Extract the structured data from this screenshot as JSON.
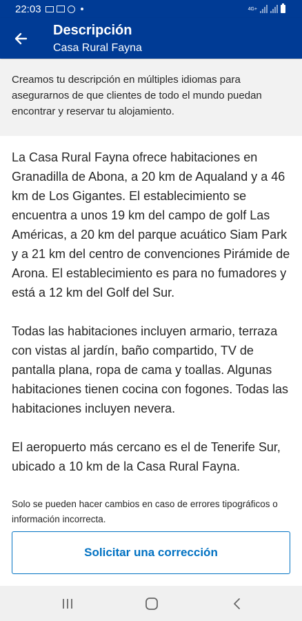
{
  "status_bar": {
    "time": "22:03",
    "network_label": "4G+"
  },
  "app_bar": {
    "title": "Descripción",
    "subtitle": "Casa Rural Fayna"
  },
  "info": {
    "text": "Creamos tu descripción en múltiples idiomas para asegurarnos de que clientes de todo el mundo puedan encontrar y reservar tu alojamiento."
  },
  "description": {
    "paragraphs": [
      "La Casa Rural Fayna ofrece habitaciones en Granadilla de Abona, a 20 km de Aqualand y a 46 km de Los Gigantes. El establecimiento se encuentra a unos 19 km del campo de golf Las Américas, a 20 km del parque acuático Siam Park y a 21 km del centro de convenciones Pirámide de Arona. El establecimiento es para no fumadores y está a 12 km del Golf del Sur.",
      "Todas las habitaciones incluyen armario, terraza con vistas al jardín, baño compartido, TV de pantalla plana, ropa de cama y toallas. Algunas habitaciones tienen cocina con fogones. Todas las habitaciones incluyen nevera.",
      "El aeropuerto más cercano es el de Tenerife Sur, ubicado a 10 km de la Casa Rural Fayna."
    ]
  },
  "note": "Solo se pueden hacer cambios en caso de errores tipográficos o información incorrecta.",
  "correction_button_label": "Solicitar una corrección",
  "colors": {
    "brand_blue": "#003b95",
    "link_blue": "#0071c2",
    "info_bg": "#f2f2f2"
  }
}
